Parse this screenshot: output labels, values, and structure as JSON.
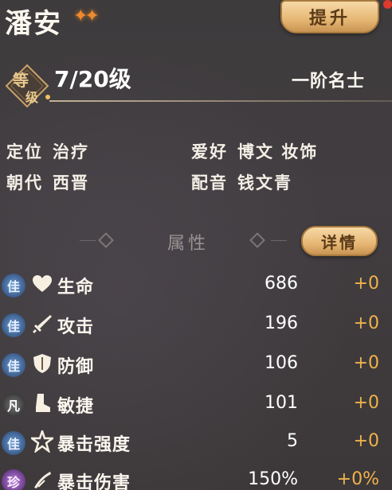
{
  "hero": {
    "name": "潘安",
    "stars": "✦✦",
    "promote_label": "提升"
  },
  "level": {
    "badge_top": "等",
    "badge_bottom": "级",
    "value": "7/20级",
    "rank": "一阶名士"
  },
  "info": {
    "role_key": "定位",
    "role_value": "治疗",
    "hobby_key": "爱好",
    "hobby_value": "博文 妆饰",
    "dynasty_key": "朝代",
    "dynasty_value": "西晋",
    "voice_key": "配音",
    "voice_value": "钱文青"
  },
  "attributes": {
    "title": "属性",
    "detail_label": "详情",
    "rows": [
      {
        "quality": "佳",
        "icon": "heart-icon",
        "name": "生命",
        "value": "686",
        "bonus": "+0"
      },
      {
        "quality": "佳",
        "icon": "sword-icon",
        "name": "攻击",
        "value": "196",
        "bonus": "+0"
      },
      {
        "quality": "佳",
        "icon": "shield-icon",
        "name": "防御",
        "value": "106",
        "bonus": "+0"
      },
      {
        "quality": "凡",
        "icon": "boot-icon",
        "name": "敏捷",
        "value": "101",
        "bonus": "+0"
      },
      {
        "quality": "佳",
        "icon": "burst-icon",
        "name": "暴击强度",
        "value": "5",
        "bonus": "+0"
      },
      {
        "quality": "珍",
        "icon": "slash-icon",
        "name": "暴击伤害",
        "value": "150%",
        "bonus": "+0%"
      }
    ]
  },
  "colors": {
    "background": "#3f3b3d",
    "gold_button": "#e6b774",
    "bonus": "#f0b24a",
    "quality_jia": "#4f79b0",
    "quality_fan": "#555555",
    "quality_zhen": "#8a50b0"
  }
}
